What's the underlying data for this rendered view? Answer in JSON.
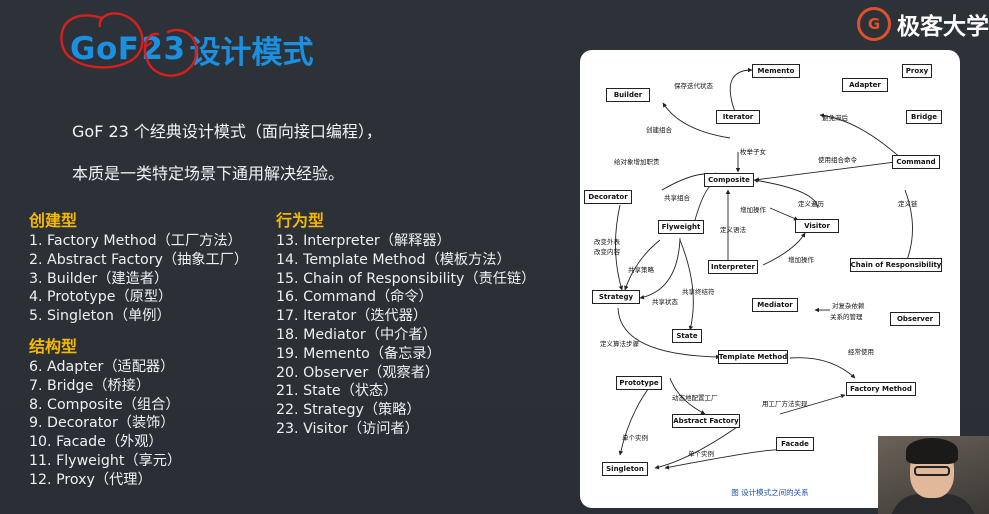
{
  "title": {
    "gof": "GoF",
    "num": "23",
    "rest": "设计模式"
  },
  "intro": {
    "line1": "GoF 23 个经典设计模式（面向接口编程），",
    "line2": "本质是一类特定场景下通用解决经验。"
  },
  "logo": {
    "mark": "G",
    "text": "极客大学"
  },
  "creational": {
    "heading": "创建型",
    "items": [
      "1. Factory Method（工厂方法）",
      "2. Abstract Factory（抽象工厂）",
      "3. Builder（建造者）",
      "4. Prototype（原型）",
      "5. Singleton（单例）"
    ]
  },
  "structural": {
    "heading": "结构型",
    "items": [
      "6. Adapter（适配器）",
      "7. Bridge（桥接）",
      "8. Composite（组合）",
      "9. Decorator（装饰）",
      "10. Facade（外观）",
      "11. Flyweight（享元）",
      "12. Proxy（代理）"
    ]
  },
  "behavioral": {
    "heading": "行为型",
    "items": [
      "13. Interpreter（解释器）",
      "14. Template Method（模板方法）",
      "15. Chain of Responsibility（责任链）",
      "16. Command（命令）",
      "17. Iterator（迭代器）",
      "18. Mediator（中介者）",
      "19. Memento（备忘录）",
      "20. Observer（观察者）",
      "21. State（状态）",
      "22. Strategy（策略）",
      "23. Visitor（访问者）"
    ]
  },
  "diagram": {
    "caption": "图 设计模式之间的关系",
    "boxes": {
      "memento": "Memento",
      "adapter": "Adapter",
      "proxy": "Proxy",
      "builder": "Builder",
      "iterator": "Iterator",
      "bridge": "Bridge",
      "command": "Command",
      "composite": "Composite",
      "decorator": "Decorator",
      "flyweight": "Flyweight",
      "visitor": "Visitor",
      "interpreter": "Interpreter",
      "chain": "Chain of Responsibility",
      "strategy": "Strategy",
      "mediator": "Mediator",
      "observer": "Observer",
      "state": "State",
      "template": "Template Method",
      "prototype": "Prototype",
      "factory_method": "Factory Method",
      "abstract_factory": "Abstract Factory",
      "facade": "Facade",
      "singleton": "Singleton"
    },
    "relations": {
      "save_iter_state": "保存迭代状态",
      "avoid_lag": "避免滞后",
      "create_composite": "创建组合",
      "enumerate_children": "枚举子女",
      "add_duty": "给对象增加职责",
      "use_composite_cmd": "使用组合命令",
      "share_composite": "共享组合",
      "add_op_1": "增加操作",
      "define_traverse": "定义遍历",
      "define_chain": "定义链",
      "change_skin": "改变外表",
      "change_content": "改变内容",
      "define_grammar": "定义语法",
      "share_strategy": "共享策略",
      "add_op_2": "增加操作",
      "share_terminal": "共享终结符",
      "share_state": "共享状态",
      "complex_dep": "对复杂依赖",
      "relation_mgmt": "关系的管理",
      "define_algo_steps": "定义算法步骤",
      "often_use": "经常使用",
      "dyn_config_factory": "动态地配置工厂",
      "impl_with_fm": "用工厂方法实现",
      "single_instance_1": "单个实例",
      "single_instance_2": "单个实例"
    }
  }
}
